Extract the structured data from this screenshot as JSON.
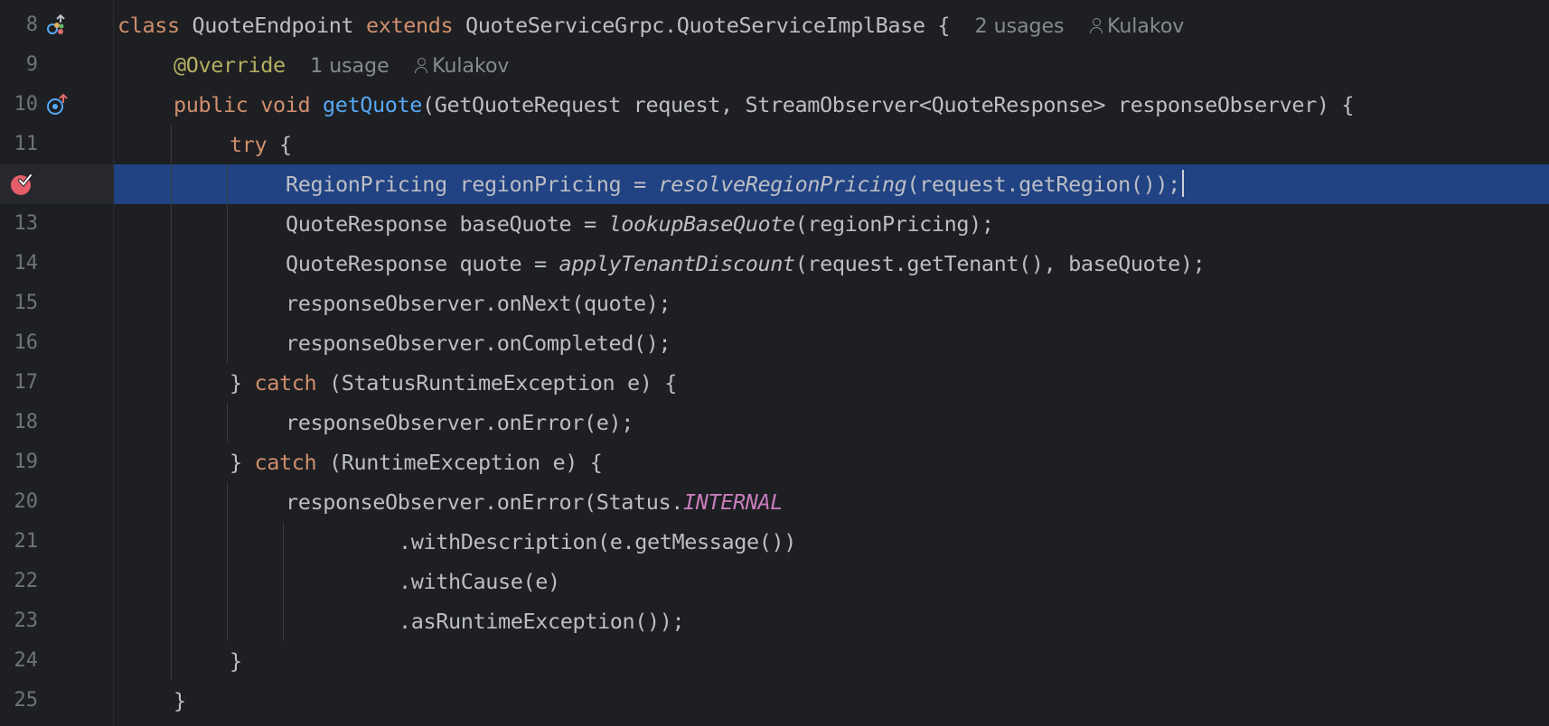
{
  "editor": {
    "theme": {
      "background": "#1e1f22",
      "highlight": "#214283",
      "keyword": "#cf8e6d",
      "function": "#56a8f5",
      "annotation": "#b3ae60",
      "constant": "#c77dbb"
    },
    "lines": [
      {
        "num": "8",
        "t0": "class",
        "t1": " QuoteEndpoint ",
        "t2": "extends",
        "t3": " QuoteServiceGrpc.QuoteServiceImplBase {",
        "usages": "2 usages",
        "author": "Kulakov",
        "gutter_icon": "implemented-interface-icon"
      },
      {
        "num": "9",
        "t0": "@Override",
        "usages": "1 usage",
        "author": "Kulakov"
      },
      {
        "num": "10",
        "t0": "public",
        "t1": " ",
        "t2": "void",
        "t3": " ",
        "t4": "getQuote",
        "t5": "(GetQuoteRequest request, StreamObserver<QuoteResponse> responseObserver) {",
        "gutter_icon": "override-method-icon"
      },
      {
        "num": "11",
        "t0": "try",
        "t1": " {"
      },
      {
        "num": "",
        "t0": "RegionPricing regionPricing = ",
        "t1": "resolveRegionPricing",
        "t2": "(request.getRegion());",
        "gutter_icon": "breakpoint-icon"
      },
      {
        "num": "13",
        "t0": "QuoteResponse baseQuote = ",
        "t1": "lookupBaseQuote",
        "t2": "(regionPricing);"
      },
      {
        "num": "14",
        "t0": "QuoteResponse quote = ",
        "t1": "applyTenantDiscount",
        "t2": "(request.getTenant(), baseQuote);"
      },
      {
        "num": "15",
        "t0": "responseObserver.onNext(quote);"
      },
      {
        "num": "16",
        "t0": "responseObserver.onCompleted();"
      },
      {
        "num": "17",
        "t0": "} ",
        "t1": "catch",
        "t2": " (StatusRuntimeException e) {"
      },
      {
        "num": "18",
        "t0": "responseObserver.onError(e);"
      },
      {
        "num": "19",
        "t0": "} ",
        "t1": "catch",
        "t2": " (RuntimeException e) {"
      },
      {
        "num": "20",
        "t0": "responseObserver.onError(Status.",
        "t1": "INTERNAL"
      },
      {
        "num": "21",
        "t0": ".withDescription(e.getMessage())"
      },
      {
        "num": "22",
        "t0": ".withCause(e)"
      },
      {
        "num": "23",
        "t0": ".asRuntimeException());"
      },
      {
        "num": "24",
        "t0": "}"
      },
      {
        "num": "25",
        "t0": "}"
      }
    ]
  }
}
